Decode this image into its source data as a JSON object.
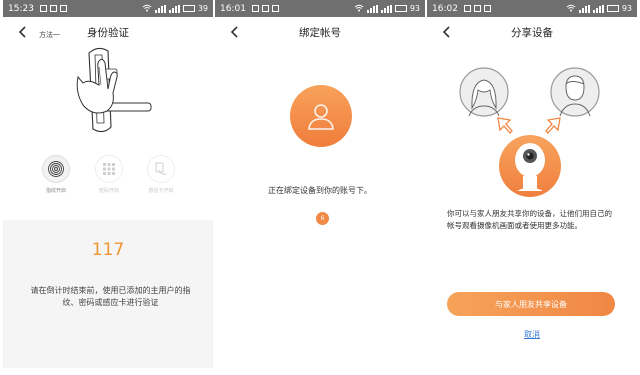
{
  "screens": [
    {
      "status": {
        "time": "15:23",
        "battery": "39",
        "battery_level": 0.39
      },
      "title": "身份验证",
      "method_label": "方法一",
      "methods": [
        {
          "label": "指纹开启",
          "icon": "fingerprint-icon",
          "active": true
        },
        {
          "label": "密码开启",
          "icon": "keypad-icon",
          "active": false
        },
        {
          "label": "感应卡开启",
          "icon": "card-hand-icon",
          "active": false
        }
      ],
      "countdown": "117",
      "instruction": "请在倒计时结束前，使用已添加的主用户的指纹、密码或感应卡进行验证"
    },
    {
      "status": {
        "time": "16:01",
        "battery": "93",
        "battery_level": 0.93
      },
      "title": "绑定帐号",
      "message": "正在绑定设备到你的账号下。",
      "count": "6"
    },
    {
      "status": {
        "time": "16:02",
        "battery": "93",
        "battery_level": 0.93
      },
      "title": "分享设备",
      "description": "你可以与家人朋友共享你的设备，让他们用自己的帐号观看摄像机画面或者使用更多功能。",
      "share_button": "与家人朋友共享设备",
      "cancel": "取消"
    }
  ],
  "colors": {
    "accent": "#f08744",
    "link": "#3a7bd5",
    "statusbar": "#6f6f6f"
  }
}
